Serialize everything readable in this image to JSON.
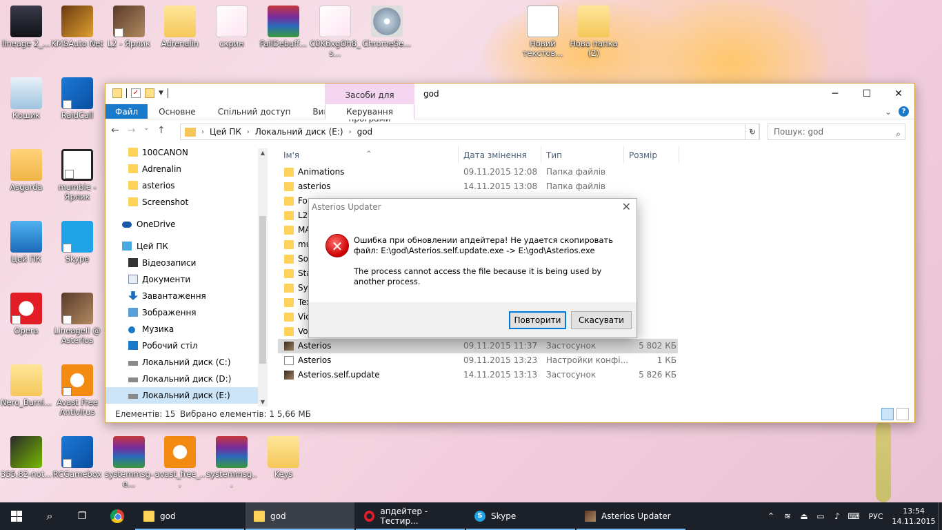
{
  "desktop": {
    "icons": [
      {
        "label": "lineage 2_..."
      },
      {
        "label": "KMSAuto Net"
      },
      {
        "label": "L2 - Ярлик"
      },
      {
        "label": "Adrenalin"
      },
      {
        "label": "скрин"
      },
      {
        "label": "FailDebuff..."
      },
      {
        "label": "C0K6xgOh8_s..."
      },
      {
        "label": "ChromeSe..."
      },
      {
        "label": "Новий текстов..."
      },
      {
        "label": "Нова папка (2)"
      },
      {
        "label": "Кошик"
      },
      {
        "label": "RaidCall"
      },
      {
        "label": "Asgarda"
      },
      {
        "label": "mumble - Ярлик"
      },
      {
        "label": "Цей ПК"
      },
      {
        "label": "Skype"
      },
      {
        "label": "Opera"
      },
      {
        "label": "LineageII @ Asterios"
      },
      {
        "label": "Nero_Burni..."
      },
      {
        "label": "Avast Free Antivirus"
      },
      {
        "label": "355.82-not..."
      },
      {
        "label": "RCGamebox"
      },
      {
        "label": "systemmsg-e..."
      },
      {
        "label": "avast_free_..."
      },
      {
        "label": "systemmsg..."
      },
      {
        "label": "Keys"
      }
    ]
  },
  "explorer": {
    "title": "god",
    "context_tab": "Засоби для програми",
    "context_subtab": "Керування",
    "ribbon_tabs": [
      "Файл",
      "Основне",
      "Спільний доступ",
      "Вигляд"
    ],
    "address": [
      "Цей ПК",
      "Локальний диск (E:)",
      "god"
    ],
    "search_placeholder": "Пошук: god",
    "nav_items": [
      {
        "label": "100CANON",
        "icon": "folder"
      },
      {
        "label": "Adrenalin",
        "icon": "folder"
      },
      {
        "label": "asterios",
        "icon": "folder"
      },
      {
        "label": "Screenshot",
        "icon": "folder"
      },
      {
        "label": "OneDrive",
        "icon": "cloud"
      },
      {
        "label": "Цей ПК",
        "icon": "pc"
      },
      {
        "label": "Відеозаписи",
        "icon": "video"
      },
      {
        "label": "Документи",
        "icon": "doc"
      },
      {
        "label": "Завантаження",
        "icon": "download"
      },
      {
        "label": "Зображення",
        "icon": "picture"
      },
      {
        "label": "Музика",
        "icon": "music"
      },
      {
        "label": "Робочий стіл",
        "icon": "desktop"
      },
      {
        "label": "Локальний диск (C:)",
        "icon": "drive"
      },
      {
        "label": "Локальний диск (D:)",
        "icon": "drive"
      },
      {
        "label": "Локальний диск (E:)",
        "icon": "drive"
      }
    ],
    "columns": {
      "name": "Ім'я",
      "date": "Дата змінення",
      "type": "Тип",
      "size": "Розмір"
    },
    "files": [
      {
        "name": "Animations",
        "date": "09.11.2015 12:08",
        "type": "Папка файлів",
        "size": "",
        "icon": "folder"
      },
      {
        "name": "asterios",
        "date": "14.11.2015 13:08",
        "type": "Папка файлів",
        "size": "",
        "icon": "folder"
      },
      {
        "name": "For",
        "date": "",
        "type": "",
        "size": "",
        "icon": "folder"
      },
      {
        "name": "L2t",
        "date": "",
        "type": "",
        "size": "",
        "icon": "folder"
      },
      {
        "name": "MA",
        "date": "",
        "type": "",
        "size": "",
        "icon": "folder"
      },
      {
        "name": "mu",
        "date": "",
        "type": "",
        "size": "",
        "icon": "folder"
      },
      {
        "name": "Sou",
        "date": "",
        "type": "",
        "size": "",
        "icon": "folder"
      },
      {
        "name": "Sta",
        "date": "",
        "type": "",
        "size": "",
        "icon": "folder"
      },
      {
        "name": "Sys",
        "date": "",
        "type": "",
        "size": "",
        "icon": "folder"
      },
      {
        "name": "Tex",
        "date": "",
        "type": "",
        "size": "",
        "icon": "folder"
      },
      {
        "name": "Vid",
        "date": "",
        "type": "",
        "size": "",
        "icon": "folder"
      },
      {
        "name": "Voi",
        "date": "",
        "type": "",
        "size": "",
        "icon": "folder"
      },
      {
        "name": "Asterios",
        "date": "09.11.2015 11:37",
        "type": "Застосунок",
        "size": "5 802 КБ",
        "icon": "exe"
      },
      {
        "name": "Asterios",
        "date": "09.11.2015 13:23",
        "type": "Настройки конфі...",
        "size": "1 КБ",
        "icon": "cfg"
      },
      {
        "name": "Asterios.self.update",
        "date": "14.11.2015 13:13",
        "type": "Застосунок",
        "size": "5 826 КБ",
        "icon": "exe"
      }
    ],
    "status": {
      "count": "Елементів: 15",
      "selected": "Вибрано елементів: 1  5,66 МБ"
    }
  },
  "dialog": {
    "title": "Asterios Updater",
    "message_1": "Ошибка при обновлении апдейтера! Не удается скопировать файл: E:\\god\\Asterios.self.update.exe -> E:\\god\\Asterios.exe",
    "message_2": "The process cannot access the file because it is being used by another process.",
    "retry": "Повторити",
    "cancel": "Скасувати"
  },
  "taskbar": {
    "items": [
      {
        "label": "god"
      },
      {
        "label": "god"
      },
      {
        "label": "апдейтер - Тестир..."
      },
      {
        "label": "Skype"
      },
      {
        "label": "Asterios Updater"
      }
    ],
    "lang": "РУС",
    "time": "13:54",
    "date": "14.11.2015"
  }
}
